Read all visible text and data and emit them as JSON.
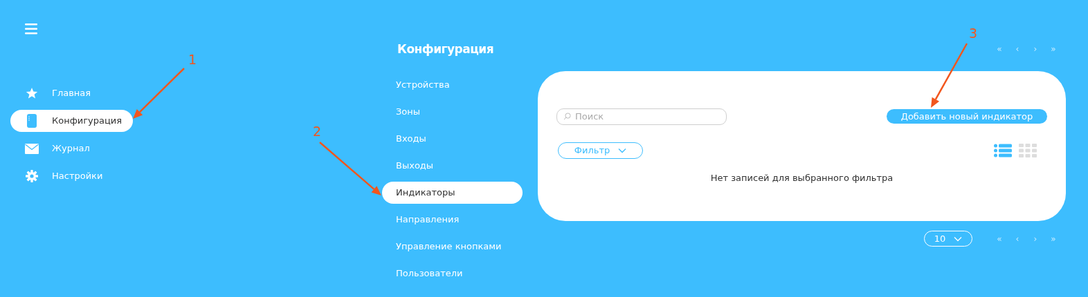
{
  "sidebar": {
    "items": [
      {
        "label": "Главная",
        "selected": false
      },
      {
        "label": "Конфигурация",
        "selected": true
      },
      {
        "label": "Журнал",
        "selected": false
      },
      {
        "label": "Настройки",
        "selected": false
      }
    ]
  },
  "section": {
    "title": "Конфигурация",
    "items": [
      {
        "label": "Устройства",
        "selected": false
      },
      {
        "label": "Зоны",
        "selected": false
      },
      {
        "label": "Входы",
        "selected": false
      },
      {
        "label": "Выходы",
        "selected": false
      },
      {
        "label": "Индикаторы",
        "selected": true
      },
      {
        "label": "Направления",
        "selected": false
      },
      {
        "label": "Управление кнопками",
        "selected": false
      },
      {
        "label": "Пользователи",
        "selected": false
      }
    ]
  },
  "pager_top": [
    "«",
    "‹",
    "›",
    "»"
  ],
  "search": {
    "placeholder": "Поиск"
  },
  "add_button": "Добавить новый индикатор",
  "filter_button": "Фильтр",
  "view_toggle": [
    {
      "kind": "list",
      "selected": true
    },
    {
      "kind": "grid",
      "selected": false
    }
  ],
  "empty_message": "Нет записей для выбранного фильтра",
  "page_size": "10",
  "pager_bottom": [
    "«",
    "‹",
    "›",
    "»"
  ],
  "annotations": [
    {
      "label": "1"
    },
    {
      "label": "2"
    },
    {
      "label": "3"
    }
  ]
}
